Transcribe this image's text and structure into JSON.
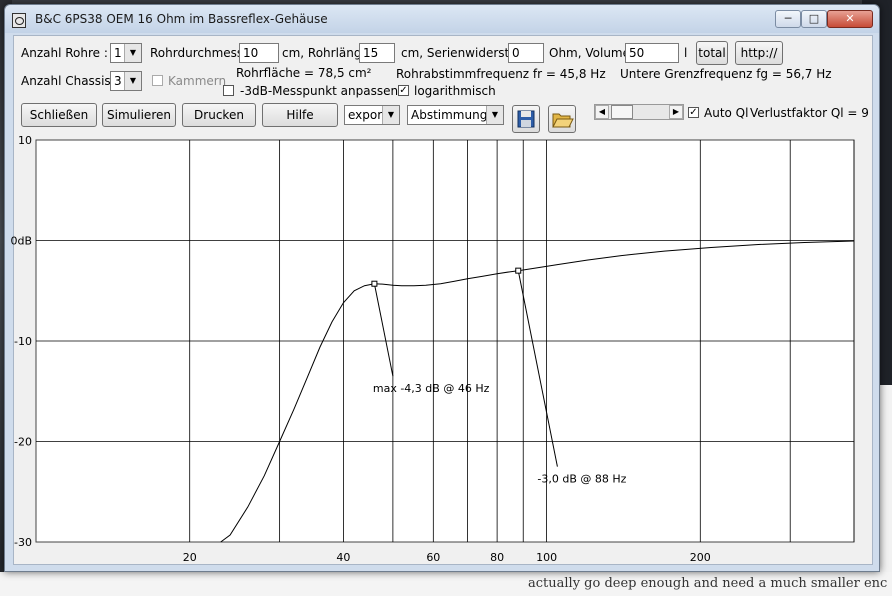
{
  "window": {
    "title": "B&C 6PS38 OEM 16 Ohm im Bassreflex-Gehäuse",
    "controls": {
      "minimize": "─",
      "maximize": "□",
      "close": "✕"
    }
  },
  "row1": {
    "anzahl_rohre_label": "Anzahl Rohre :",
    "anzahl_rohre_value": "1",
    "rohrdurchmesser_label": "Rohrdurchmesser",
    "rohrdurchmesser_value": "10",
    "rohrlaenge_label": "cm, Rohrlänge",
    "rohrlaenge_value": "15",
    "serienwiderstand_label": "cm, Serienwiderstand",
    "serienwiderstand_value": "0",
    "volumen_label": "Ohm, Volumen",
    "volumen_value": "50",
    "volumen_unit": "l",
    "total_button": "total",
    "http_button": "http://"
  },
  "row2": {
    "anzahl_chassis_label": "Anzahl Chassis :",
    "anzahl_chassis_value": "3",
    "kammern_label": "Kammern",
    "rohrflaeche": "Rohrfläche = 78,5 cm²",
    "messpunkt_label": "-3dB-Messpunkt anpassen",
    "rohrabstimm": "Rohrabstimmfrequenz fr = 45,8 Hz",
    "logarithmisch_label": "logarithmisch",
    "grenzfrequenz": "Untere Grenzfrequenz fg = 56,7 Hz"
  },
  "row3": {
    "schliessen_button": "Schließen",
    "simulieren_button": "Simulieren",
    "drucken_button": "Drucken",
    "hilfe_button": "Hilfe",
    "export_value": "export",
    "abstimmung_value": "Abstimmung",
    "auto_ql_label": "Auto Ql",
    "verlustfaktor": "Verlustfaktor Ql = 9"
  },
  "checks": {
    "kammern": false,
    "messpunkt": false,
    "logarithmisch": true,
    "auto_ql": true
  },
  "background": {
    "bottom_text": "actually go deep enough and need a much smaller enc"
  },
  "chart_data": {
    "type": "line",
    "title": "",
    "xscale": "log",
    "xlim": [
      10,
      400
    ],
    "ylim": [
      -30,
      10
    ],
    "yticks": [
      10,
      0,
      -10,
      -20,
      -30
    ],
    "ytick_labels": [
      "10",
      "0dB",
      "-10",
      "-20",
      "-30"
    ],
    "xticks": [
      20,
      40,
      60,
      80,
      100,
      200
    ],
    "xtick_labels": [
      "20",
      "40",
      "60",
      "80",
      "100",
      "200"
    ],
    "grid": true,
    "series": [
      {
        "x": [
          23,
          24,
          26,
          28,
          30,
          32,
          34,
          36,
          38,
          40,
          42,
          44,
          46,
          48,
          50,
          52,
          55,
          58,
          62,
          66,
          70,
          75,
          80,
          85,
          88,
          95,
          105,
          120,
          140,
          170,
          210,
          260,
          320,
          400
        ],
        "y": [
          -30.0,
          -29.3,
          -26.5,
          -23.4,
          -20.0,
          -16.8,
          -13.6,
          -10.6,
          -8.1,
          -6.2,
          -5.0,
          -4.5,
          -4.3,
          -4.35,
          -4.45,
          -4.5,
          -4.5,
          -4.45,
          -4.3,
          -4.05,
          -3.8,
          -3.55,
          -3.3,
          -3.1,
          -3.0,
          -2.75,
          -2.4,
          -1.95,
          -1.5,
          -1.05,
          -0.7,
          -0.4,
          -0.2,
          -0.05
        ]
      }
    ],
    "annotations": [
      {
        "text": "max -4,3 dB @ 46 Hz",
        "x": 46,
        "y": -4.3,
        "label_x": 50,
        "label_y": -13.5
      },
      {
        "text": "-3,0 dB @  88 Hz",
        "x": 88,
        "y": -3.0,
        "label_x": 105,
        "label_y": -22.5
      }
    ]
  }
}
